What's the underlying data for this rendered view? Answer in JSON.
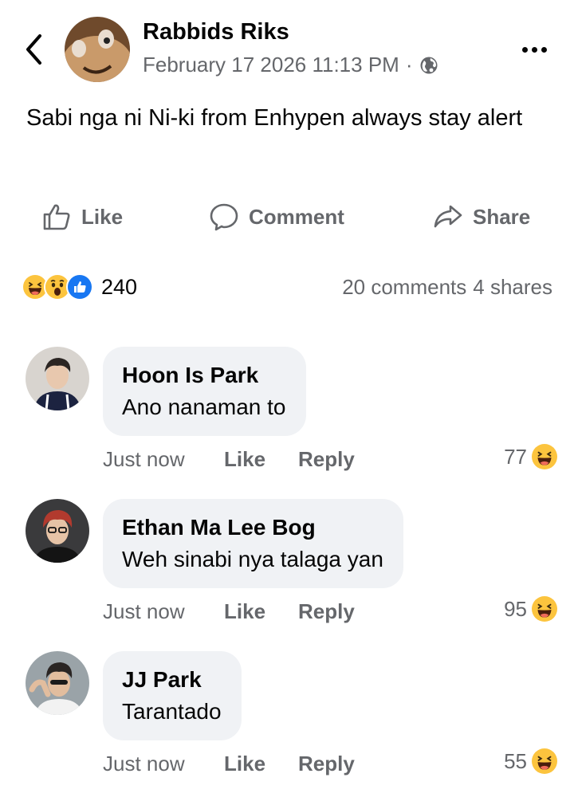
{
  "post": {
    "author": "Rabbids Riks",
    "timestamp": "February 17 2026 11:13 PM",
    "separator": "·",
    "audience_icon": "globe-icon",
    "text": "Sabi nga ni Ni-ki from Enhypen always stay alert"
  },
  "actions": {
    "like_label": "Like",
    "comment_label": "Comment",
    "share_label": "Share"
  },
  "stats": {
    "reaction_types": [
      "haha",
      "wow",
      "like"
    ],
    "reaction_count": "240",
    "comments": "20 comments",
    "shares": "4 shares"
  },
  "comments": [
    {
      "name": "Hoon Is Park",
      "text": "Ano nanaman to",
      "time": "Just now",
      "like_label": "Like",
      "reply_label": "Reply",
      "reaction_count": "77",
      "reaction_type": "haha"
    },
    {
      "name": "Ethan Ma Lee Bog",
      "text": "Weh sinabi nya talaga yan",
      "time": "Just now",
      "like_label": "Like",
      "reply_label": "Reply",
      "reaction_count": "95",
      "reaction_type": "haha"
    },
    {
      "name": "JJ Park",
      "text": "Tarantado",
      "time": "Just now",
      "like_label": "Like",
      "reply_label": "Reply",
      "reaction_count": "55",
      "reaction_type": "haha"
    }
  ],
  "colors": {
    "bubble_bg": "#f0f2f5",
    "secondary_text": "#65676b",
    "primary_text": "#050505",
    "like_blue": "#1877f2",
    "haha_yellow": "#fcc43e"
  }
}
